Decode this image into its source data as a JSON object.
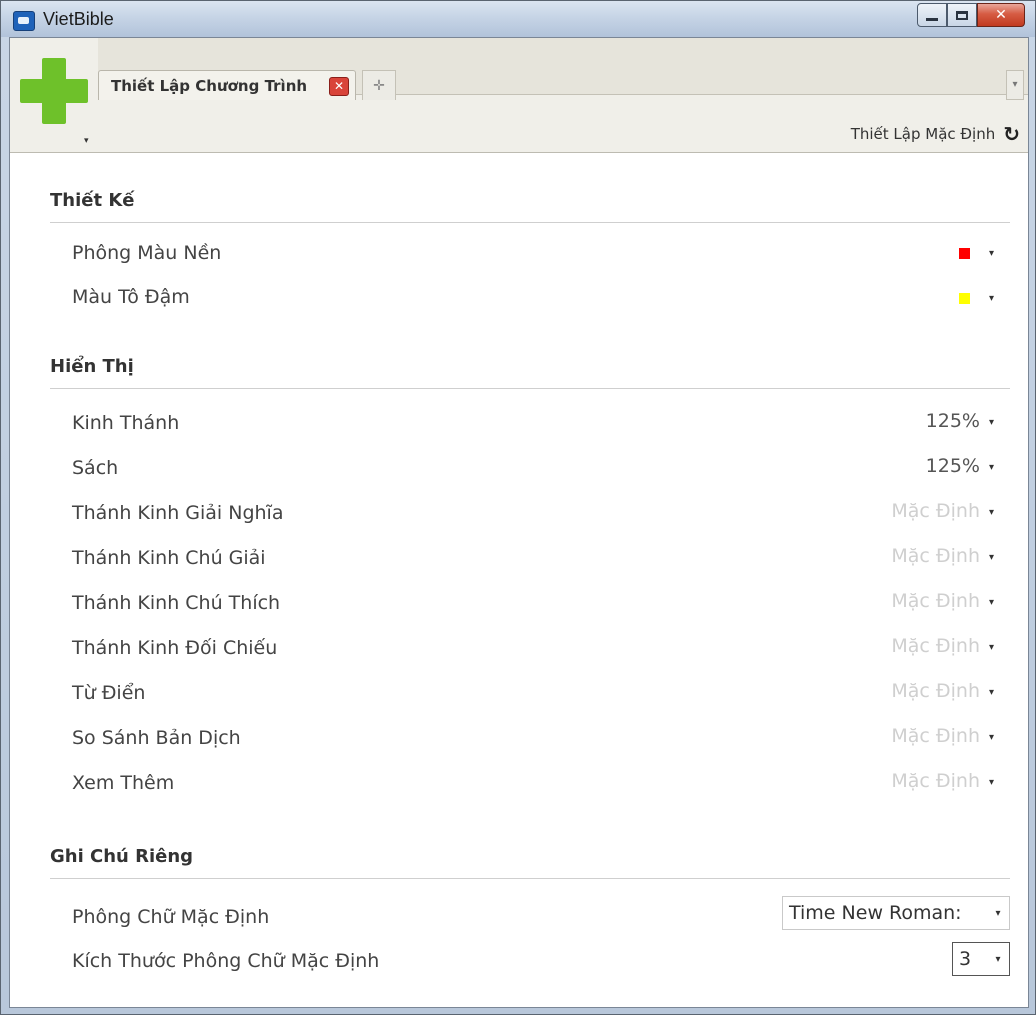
{
  "window": {
    "title": "VietBible"
  },
  "tabs": {
    "active_label": "Thiết Lập Chương Trình",
    "close_glyph": "✕",
    "add_glyph": "✛",
    "overflow_glyph": "▾"
  },
  "toolbar": {
    "reset_label": "Thiết Lập Mặc Định",
    "reset_icon": "↻"
  },
  "sections": {
    "design": {
      "title": "Thiết Kế",
      "rows": [
        {
          "label": "Phông Màu Nền",
          "color": "#ff0000"
        },
        {
          "label": "Màu Tô Đậm",
          "color": "#ffff00"
        }
      ]
    },
    "display": {
      "title": "Hiển Thị",
      "rows": [
        {
          "label": "Kinh Thánh",
          "value": "125%"
        },
        {
          "label": "Sách",
          "value": "125%"
        },
        {
          "label": "Thánh Kinh Giải Nghĩa",
          "value": "Mặc Định"
        },
        {
          "label": "Thánh Kinh Chú Giải",
          "value": "Mặc Định"
        },
        {
          "label": "Thánh Kinh Chú Thích",
          "value": "Mặc Định"
        },
        {
          "label": "Thánh Kinh Đối Chiếu",
          "value": "Mặc Định"
        },
        {
          "label": "Từ Điển",
          "value": "Mặc Định"
        },
        {
          "label": "So Sánh Bản Dịch",
          "value": "Mặc Định"
        },
        {
          "label": "Xem Thêm",
          "value": "Mặc Định"
        }
      ]
    },
    "notes": {
      "title": "Ghi Chú Riêng",
      "rows": [
        {
          "label": "Phông Chữ Mặc Định",
          "value": "Time New Roman:"
        },
        {
          "label": "Kích Thước Phông Chữ Mặc Định",
          "value": "3"
        }
      ]
    }
  },
  "caret_glyph": "▾"
}
